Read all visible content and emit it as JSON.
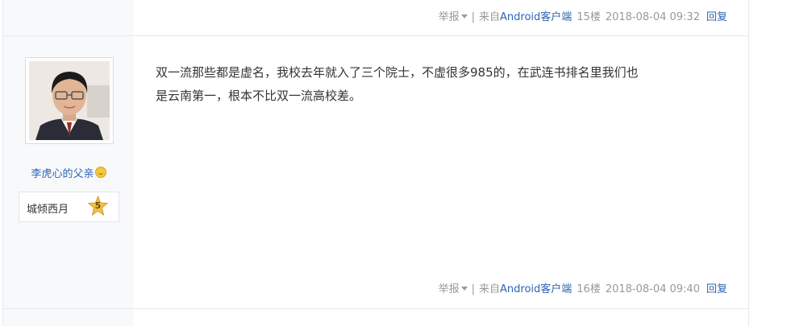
{
  "previous_post": {
    "report_label": "举报",
    "from_label": "来自",
    "client_label": "Android客户端",
    "floor": "15楼",
    "time": "2018-08-04 09:32",
    "reply_label": "回复"
  },
  "post": {
    "author": {
      "username": "李虎心的父亲",
      "badge_name": "城倾西月",
      "level": "5"
    },
    "content_line1": "双一流那些都是虚名，我校去年就入了三个院士，不虚很多985的，在武连书排名里我们也",
    "content_line2": "是云南第一，根本不比双一流高校差。",
    "report_label": "举报",
    "from_label": "来自",
    "client_label": "Android客户端",
    "floor": "16楼",
    "time": "2018-08-04 09:40",
    "reply_label": "回复"
  },
  "colors": {
    "link": "#2d64b3",
    "meta_gray": "#999999",
    "side_bg": "#f8f9fb",
    "border": "#e6e8ee",
    "text": "#333333"
  }
}
